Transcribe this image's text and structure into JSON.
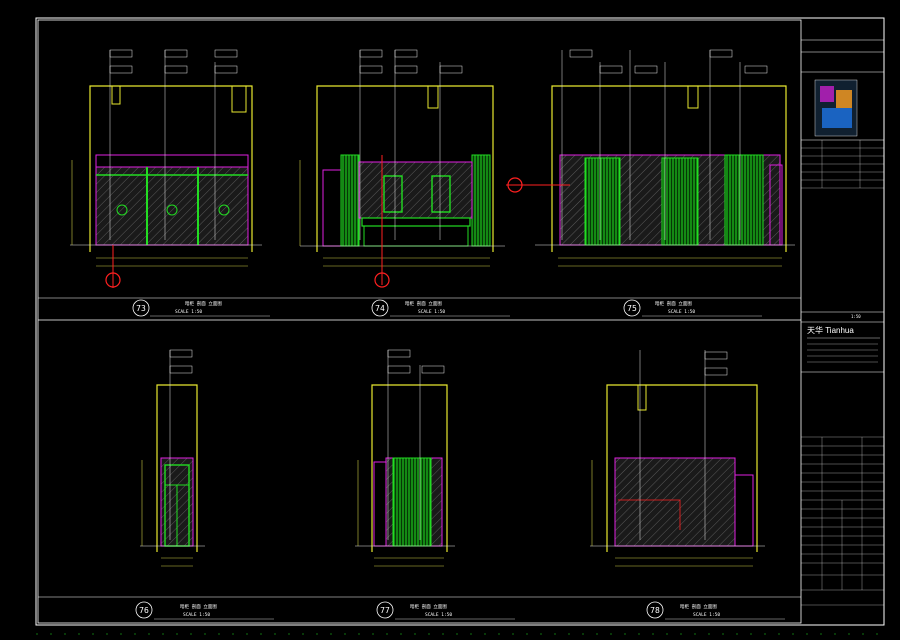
{
  "sheet": {
    "colors": {
      "frame": "#ffffff",
      "outline": "#e8e830",
      "glass": "#22dd22",
      "accent": "#e020e0",
      "dim": "#cccc44",
      "marker": "#ff2020",
      "leader": "#e8e8e8",
      "hatch": "#5a5a5a"
    },
    "elevations": [
      {
        "number": "73",
        "title": "暗柜 剖面 立面图",
        "scale": "SCALE 1:50"
      },
      {
        "number": "74",
        "title": "暗柜 剖面 立面图",
        "scale": "SCALE 1:50"
      },
      {
        "number": "75",
        "title": "暗柜 剖面 立面图",
        "scale": "SCALE 1:50"
      },
      {
        "number": "76",
        "title": "暗柜 剖面 立面图",
        "scale": "SCALE 1:50"
      },
      {
        "number": "77",
        "title": "暗柜 剖面 立面图",
        "scale": "SCALE 1:50"
      },
      {
        "number": "78",
        "title": "暗柜 剖面 立面图",
        "scale": "SCALE 1:50"
      }
    ],
    "title_block": {
      "company_logo_text": "天华 Tianhua",
      "scale": "1:50"
    }
  }
}
